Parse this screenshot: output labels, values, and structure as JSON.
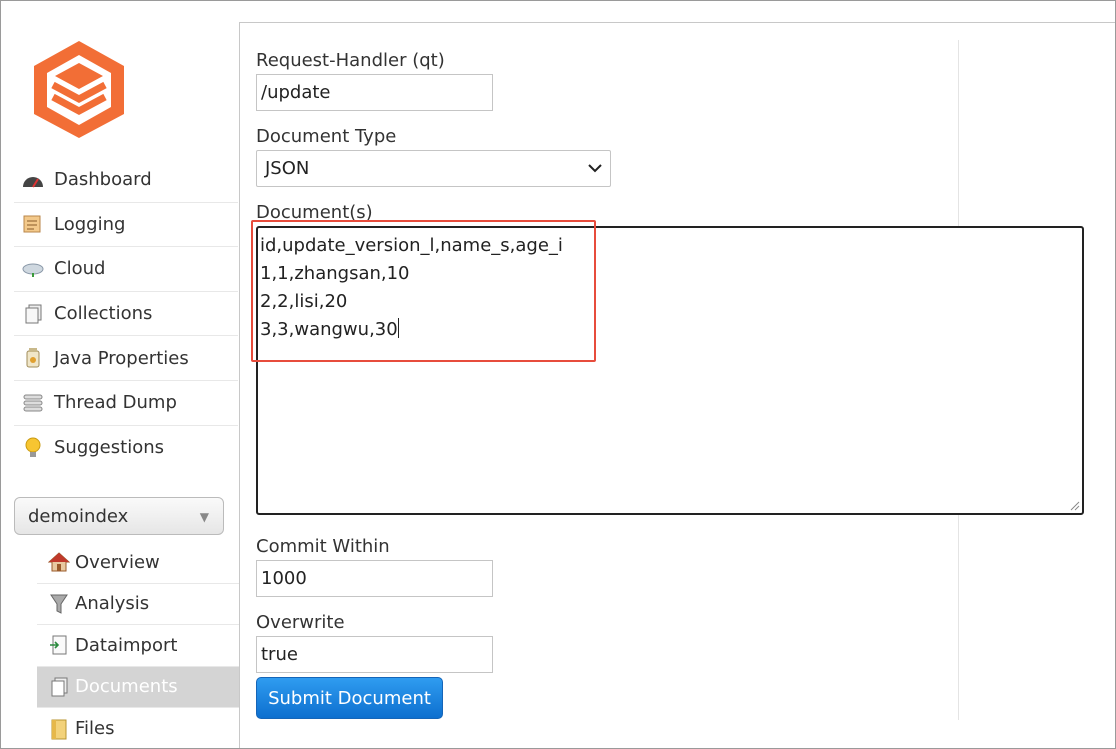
{
  "sidebar": {
    "logo_icon": "solr-logo-icon",
    "menu": [
      {
        "label": "Dashboard",
        "icon": "dashboard-icon"
      },
      {
        "label": "Logging",
        "icon": "logging-icon"
      },
      {
        "label": "Cloud",
        "icon": "cloud-icon"
      },
      {
        "label": "Collections",
        "icon": "collections-icon"
      },
      {
        "label": "Java Properties",
        "icon": "java-properties-icon"
      },
      {
        "label": "Thread Dump",
        "icon": "thread-dump-icon"
      },
      {
        "label": "Suggestions",
        "icon": "lightbulb-icon"
      }
    ],
    "core_selector": {
      "value": "demoindex"
    },
    "core_menu": [
      {
        "label": "Overview",
        "icon": "home-icon"
      },
      {
        "label": "Analysis",
        "icon": "funnel-icon"
      },
      {
        "label": "Dataimport",
        "icon": "dataimport-icon"
      },
      {
        "label": "Documents",
        "icon": "documents-icon",
        "active": true
      },
      {
        "label": "Files",
        "icon": "folder-icon"
      }
    ]
  },
  "form": {
    "request_handler": {
      "label": "Request-Handler (qt)",
      "value": "/update"
    },
    "document_type": {
      "label": "Document Type",
      "value": "JSON"
    },
    "documents": {
      "label": "Document(s)",
      "lines": [
        "id,update_version_l,name_s,age_i",
        "1,1,zhangsan,10",
        "2,2,lisi,20",
        "3,3,wangwu,30"
      ]
    },
    "commit_within": {
      "label": "Commit Within",
      "value": "1000"
    },
    "overwrite": {
      "label": "Overwrite",
      "value": "true"
    },
    "submit_label": "Submit Document"
  },
  "colors": {
    "accent": "#f26e36",
    "highlight": "#e74c3c",
    "submit": "#1a7fd9"
  }
}
